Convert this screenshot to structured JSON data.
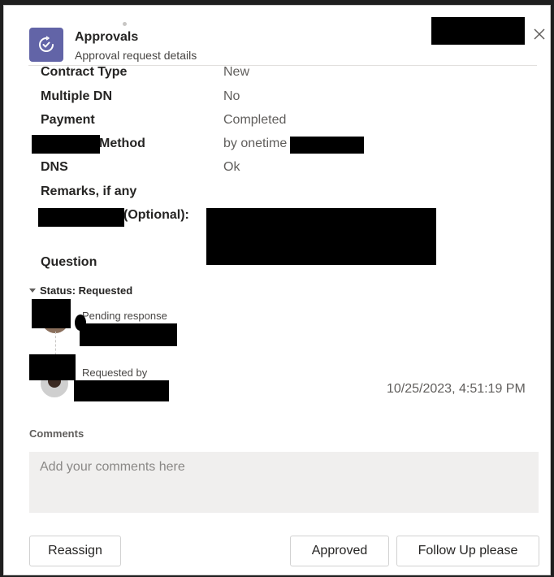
{
  "header": {
    "title": "Approvals",
    "subtitle": "Approval request details",
    "app_icon": "approvals-icon",
    "close_icon": "close-icon"
  },
  "fields": [
    {
      "label": "Contract Type",
      "value": "New"
    },
    {
      "label": "Multiple DN",
      "value": "No"
    },
    {
      "label": "Payment",
      "value": "Completed"
    },
    {
      "label": "Method",
      "value": "by onetime"
    },
    {
      "label": "DNS",
      "value": "Ok"
    },
    {
      "label": "Remarks, if any",
      "value": ""
    },
    {
      "label": "(Optional):",
      "value": ""
    },
    {
      "label": "Question",
      "value": ""
    }
  ],
  "status": {
    "header": "Status: Requested",
    "pending_label": "Pending response",
    "requested_by_label": "Requested by",
    "timestamp": "10/25/2023, 4:51:19 PM"
  },
  "comments": {
    "label": "Comments",
    "placeholder": "Add your comments here"
  },
  "buttons": {
    "reassign": "Reassign",
    "approved": "Approved",
    "follow_up": "Follow Up please"
  },
  "colors": {
    "accent": "#6264a7",
    "comment_bg": "#f0efee"
  }
}
